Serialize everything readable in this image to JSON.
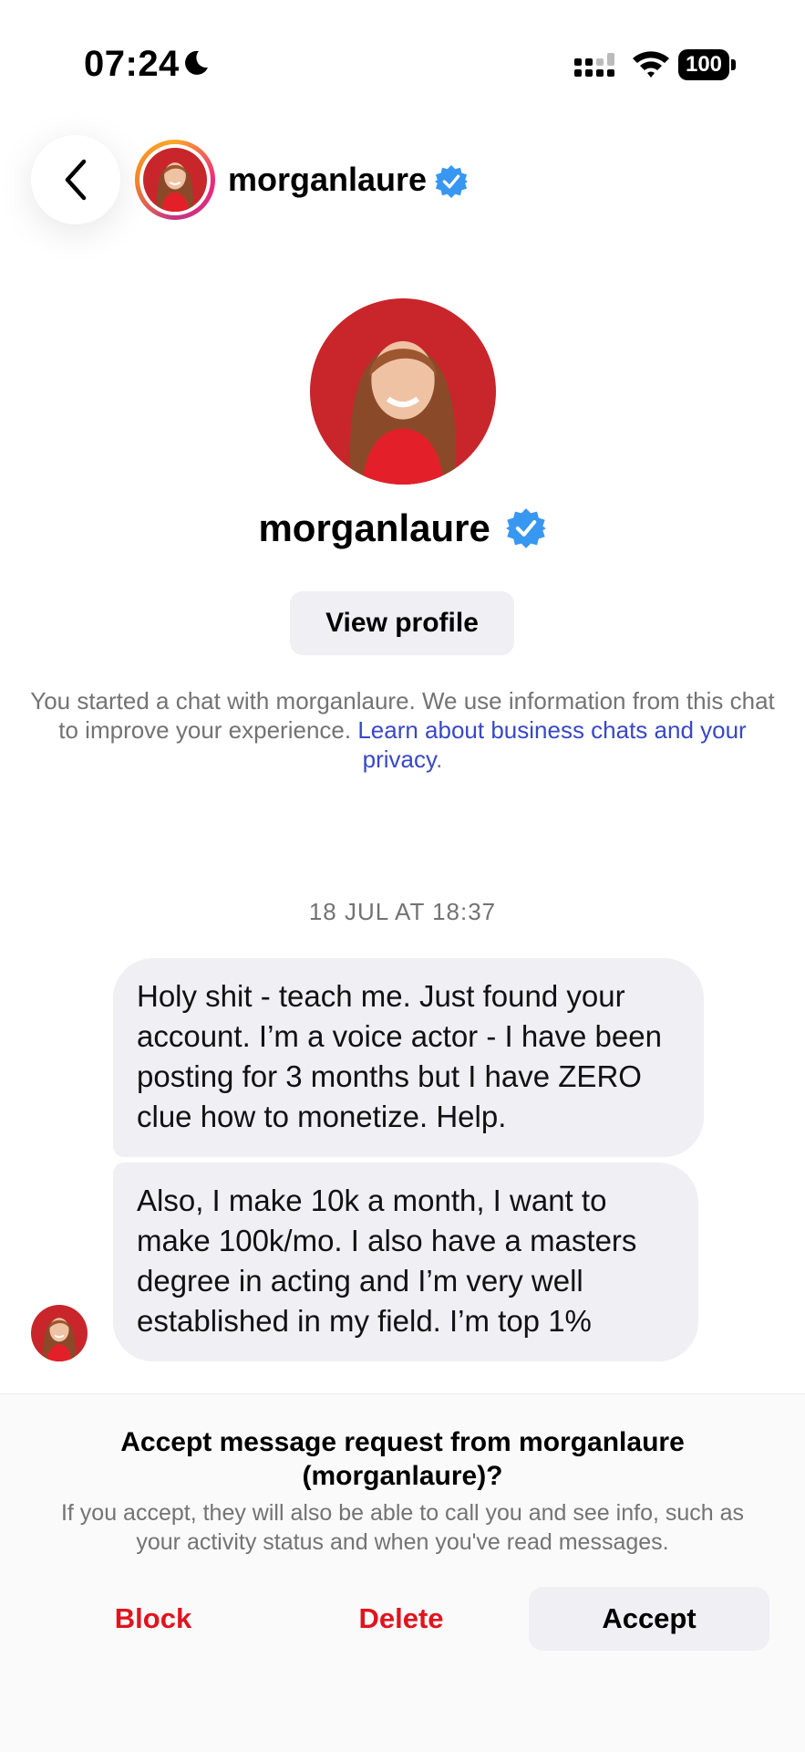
{
  "status_bar": {
    "time": "07:24",
    "battery": "100"
  },
  "header": {
    "username": "morganlaure"
  },
  "profile": {
    "name": "morganlaure",
    "view_profile_label": "View profile"
  },
  "info": {
    "text": "You started a chat with morganlaure. We use information from this chat to improve your experience. ",
    "link": "Learn about business chats and your privacy",
    "end": "."
  },
  "conversation": {
    "timestamp": "18 JUL AT 18:37",
    "messages": [
      {
        "text": "Holy shit - teach me. Just found your account. I’m a voice actor - I have been posting for 3 months but I have ZERO clue how to monetize. Help."
      },
      {
        "text": "Also, I make 10k a month, I want to make 100k/mo. I also have a masters degree in acting and I’m very well established in my field. I’m top 1%"
      }
    ]
  },
  "request": {
    "title": "Accept message request from morganlaure (morganlaure)?",
    "description": "If you accept, they will also be able to call you and see info, such as your activity status and when you've read messages.",
    "block_label": "Block",
    "delete_label": "Delete",
    "accept_label": "Accept"
  },
  "colors": {
    "verified_blue": "#3897f0",
    "link_blue": "#3848c6",
    "danger_red": "#e0141e",
    "bubble_gray": "#efeff4",
    "secondary_text": "#737373"
  }
}
